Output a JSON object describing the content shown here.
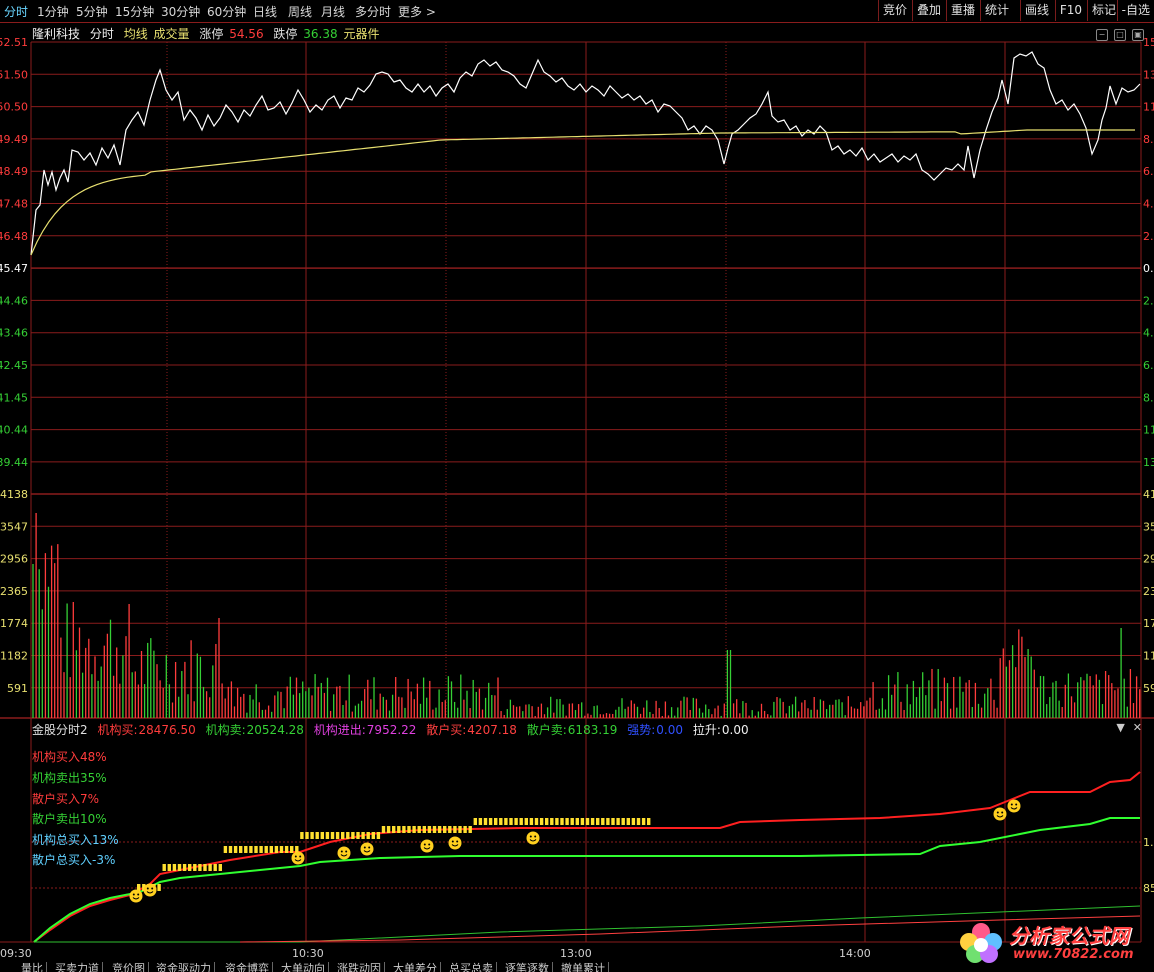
{
  "toolbar": {
    "tabs": [
      "分时",
      "1分钟",
      "5分钟",
      "15分钟",
      "30分钟",
      "60分钟",
      "日线",
      "周线",
      "月线",
      "多分时",
      "更多 >"
    ],
    "active_tab": "分时",
    "right_buttons": [
      "竞价",
      "叠加",
      "重播",
      "统计",
      "画线",
      "F10",
      "标记",
      "-自选"
    ]
  },
  "info": {
    "stock_name": "隆利科技",
    "mode": "分时",
    "avg_line": "均线",
    "volume": "成交量",
    "limit_up_label": "涨停",
    "limit_up_value": "54.56",
    "limit_down_label": "跌停",
    "limit_down_value": "36.38",
    "sector": "元器件"
  },
  "price_axis": {
    "left_labels": [
      "52.51",
      "51.50",
      "50.50",
      "49.49",
      "48.49",
      "47.48",
      "46.48",
      "45.47",
      "44.46",
      "43.46",
      "42.45",
      "41.45",
      "40.44",
      "39.44"
    ],
    "right_labels": [
      "15.",
      "13.",
      "11.",
      "8.",
      "6.",
      "4.",
      "2.",
      "0.",
      "2.",
      "4.",
      "6.",
      "8.",
      "11.",
      "13."
    ]
  },
  "volume_axis": {
    "left_labels": [
      "4138",
      "3547",
      "2956",
      "2365",
      "1774",
      "1182",
      "591"
    ],
    "right_labels": [
      "41",
      "35",
      "29",
      "23",
      "17",
      "11",
      "59"
    ]
  },
  "indicator": {
    "name": "金股分时2",
    "inst_buy_label": "机构买:",
    "inst_buy_value": "28476.50",
    "inst_sell_label": "机构卖:",
    "inst_sell_value": "20524.28",
    "inst_net_label": "机构进出:",
    "inst_net_value": "7952.22",
    "retail_buy_label": "散户买:",
    "retail_buy_value": "4207.18",
    "retail_sell_label": "散户卖:",
    "retail_sell_value": "6183.19",
    "strength_label": "强势:",
    "strength_value": "0.00",
    "pull_label": "拉升:",
    "pull_value": "0.00",
    "legend": [
      "机构买入48%",
      "机构卖出35%",
      "散户买入7%",
      "散户卖出10%",
      "机构总买入13%",
      "散户总买入-3%"
    ],
    "right_labels": [
      "1.",
      "85"
    ]
  },
  "time_axis": [
    "09:30",
    "10:30",
    "13:00",
    "14:00"
  ],
  "bottom_tabs": [
    "量比",
    "买卖力道",
    "竞价图",
    "资金驱动力",
    "资金博弈",
    "大单动向",
    "涨跌动因",
    "大单差分",
    "总买总卖",
    "逐笔逐数",
    "撤单累计"
  ],
  "watermark": {
    "title": "分析家公式网",
    "url": "www.70822.com"
  },
  "colors": {
    "grid": "#8a1c1c",
    "price_line": "#ffffff",
    "avg_line": "#e8e070",
    "up": "#ff3c3c",
    "down": "#35d035",
    "inst_net": "#e040e0",
    "retail_buy": "#ff4040",
    "strength": "#3050ff",
    "smiley": "#ffd020"
  }
}
